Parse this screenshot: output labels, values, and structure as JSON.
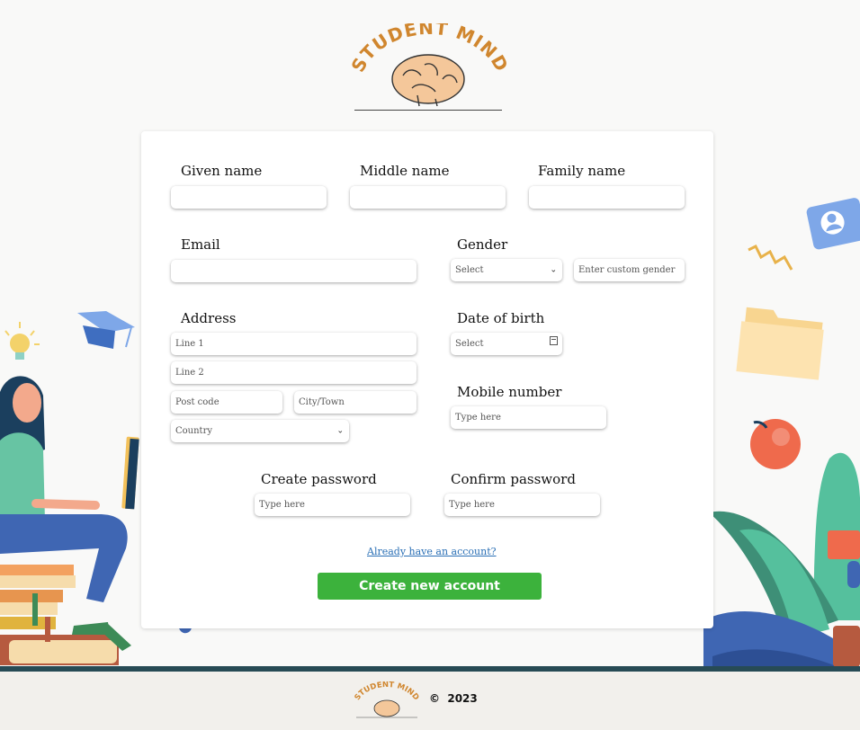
{
  "brand": {
    "logo_text": "STUDENT MIND"
  },
  "form": {
    "given_name_label": "Given name",
    "middle_name_label": "Middle name",
    "family_name_label": "Family name",
    "email_label": "Email",
    "gender_label": "Gender",
    "gender_select_value": "Select",
    "custom_gender_placeholder": "Enter custom gender",
    "address_label": "Address",
    "line1_placeholder": "Line 1",
    "line2_placeholder": "Line 2",
    "postcode_placeholder": "Post code",
    "city_placeholder": "City/Town",
    "country_value": "Country",
    "dob_label": "Date of birth",
    "dob_value": "Select",
    "mobile_label": "Mobile number",
    "mobile_placeholder": "Type here",
    "create_password_label": "Create password",
    "create_password_placeholder": "Type here",
    "confirm_password_label": "Confirm password",
    "confirm_password_placeholder": "Type here",
    "login_link": "Already have an account?",
    "submit_label": "Create new account"
  },
  "footer": {
    "copyright": "©  2023"
  },
  "colors": {
    "accent_green": "#3cb23c",
    "logo_orange": "#d0862e",
    "link_blue": "#2a6fb5",
    "footer_bar": "#274b55"
  },
  "icons": [
    "brain-icon",
    "chevron-down-icon",
    "calendar-icon",
    "id-card-icon",
    "folder-icon",
    "apple-icon",
    "graduation-cap-icon",
    "lightbulb-icon"
  ]
}
